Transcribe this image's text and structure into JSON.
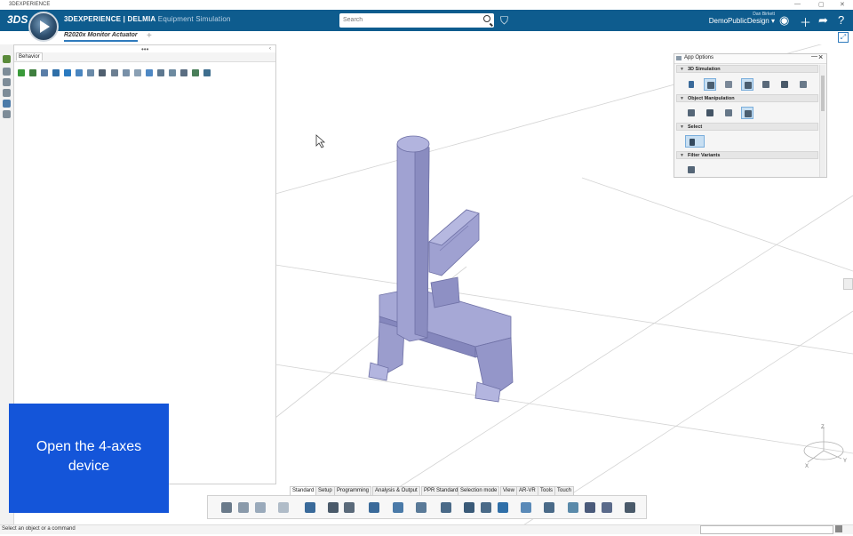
{
  "os_bar": {
    "title": "3DEXPERIENCE",
    "min": "—",
    "max": "▢",
    "close": "✕"
  },
  "header": {
    "brand_bold": "3D",
    "brand_rest": "EXPERIENCE | DELMIA",
    "app_name": "Equipment Simulation",
    "search_placeholder": "Search",
    "user_name": "Dan Birkett",
    "workspace": "DemoPublicDesign ▾"
  },
  "tabs": {
    "active": "R2020x Monitor Actuator",
    "add": "+"
  },
  "behavior_panel": {
    "tab": "Behavior",
    "dots": "•••"
  },
  "app_options": {
    "title": "App Options",
    "sections": [
      "3D Simulation",
      "Object Manipulation",
      "Select",
      "Filter Variants"
    ]
  },
  "overlay": {
    "line1": "Open the 4-axes",
    "line2": "device"
  },
  "command_tabs": [
    "Standard",
    "Setup",
    "Programming",
    "Analysis & Output",
    "PPR Standard",
    "Selection mode",
    "View",
    "AR-VR",
    "Tools",
    "Touch"
  ],
  "status": {
    "text": "Select an object or a command"
  },
  "compass_labels": {
    "x": "X",
    "y": "Y",
    "z": "Z"
  },
  "colors": {
    "header": "#0e5c8e",
    "overlay": "#1455d9",
    "model": "#9a9ccf",
    "accent": "#2f7bbd"
  }
}
